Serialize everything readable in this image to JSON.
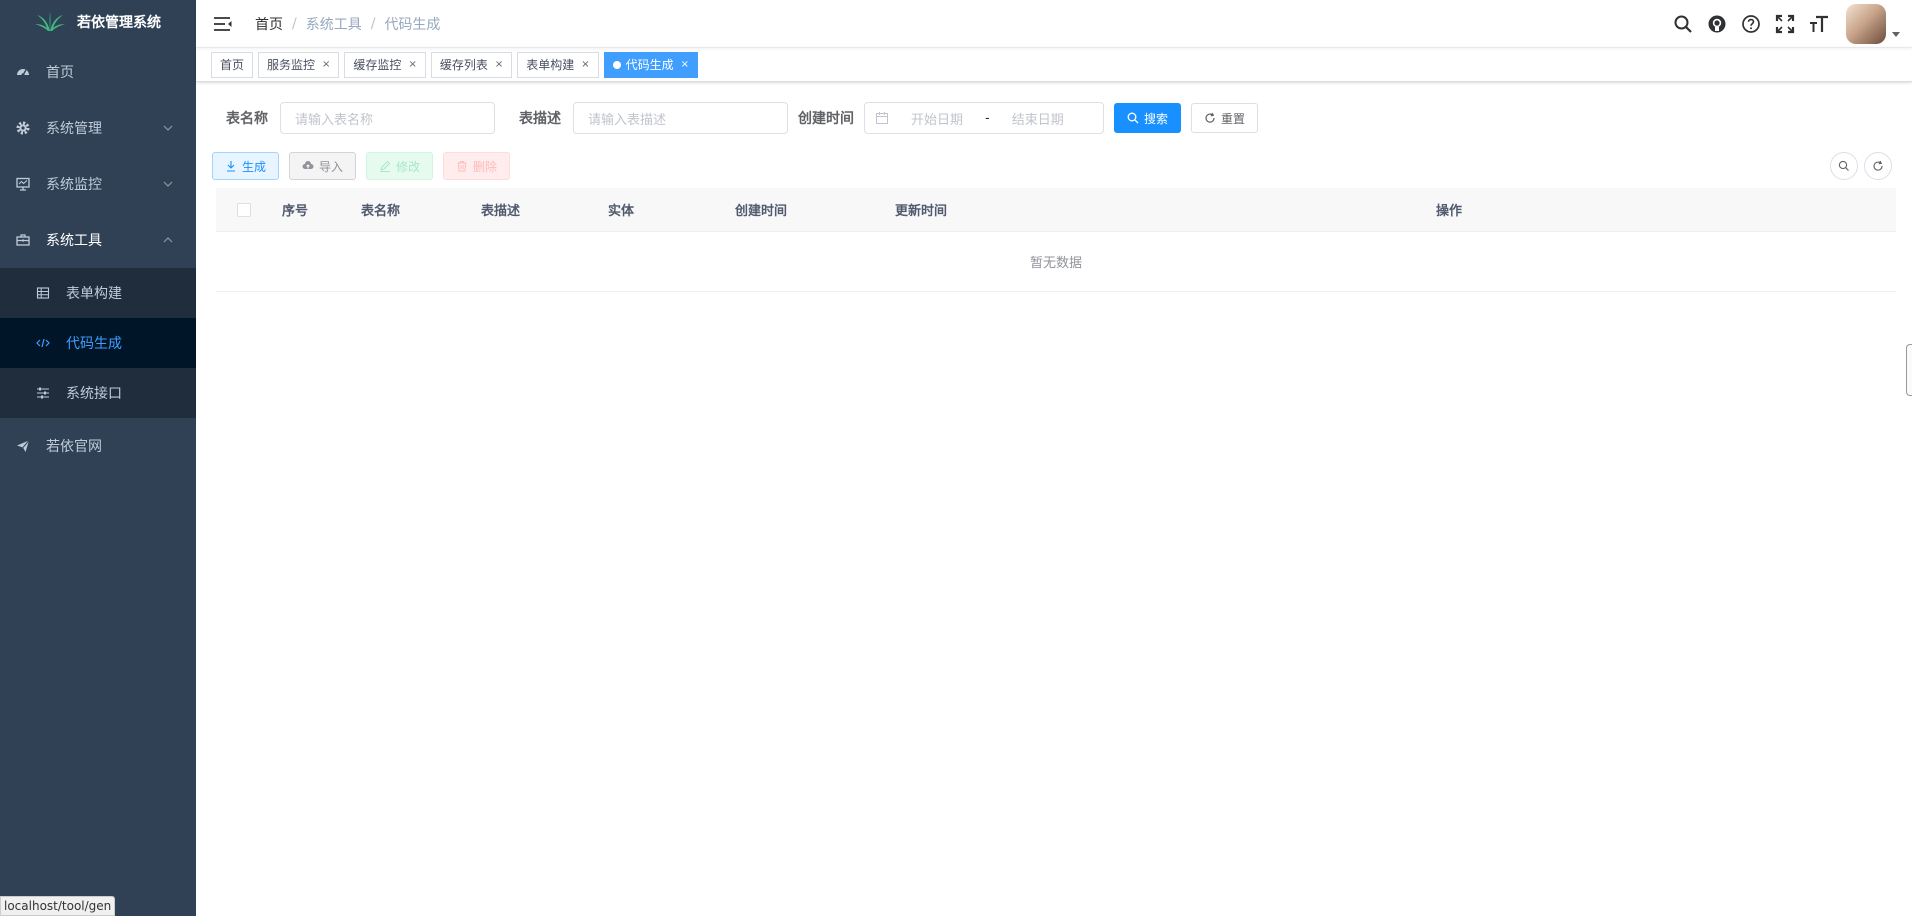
{
  "app": {
    "title": "若依管理系统"
  },
  "sidebar": {
    "items": [
      {
        "label": "首页",
        "icon": "dashboard-icon"
      },
      {
        "label": "系统管理",
        "icon": "gear-icon"
      },
      {
        "label": "系统监控",
        "icon": "monitor-icon"
      },
      {
        "label": "系统工具",
        "icon": "toolbox-icon"
      }
    ],
    "sub_items": [
      {
        "label": "表单构建",
        "icon": "grid-icon"
      },
      {
        "label": "代码生成",
        "icon": "code-icon"
      },
      {
        "label": "系统接口",
        "icon": "sliders-icon"
      }
    ],
    "official_site": "若依官网"
  },
  "breadcrumb": {
    "home": "首页",
    "section": "系统工具",
    "current": "代码生成"
  },
  "tags": [
    "首页",
    "服务监控",
    "缓存监控",
    "缓存列表",
    "表单构建",
    "代码生成"
  ],
  "search": {
    "table_name_label": "表名称",
    "table_name_placeholder": "请输入表名称",
    "table_desc_label": "表描述",
    "table_desc_placeholder": "请输入表描述",
    "created_label": "创建时间",
    "start_date_placeholder": "开始日期",
    "range_separator": "-",
    "end_date_placeholder": "结束日期",
    "search_button": "搜索",
    "reset_button": "重置"
  },
  "toolbar": {
    "generate": "生成",
    "import": "导入",
    "edit": "修改",
    "delete": "删除"
  },
  "table": {
    "columns": [
      "序号",
      "表名称",
      "表描述",
      "实体",
      "创建时间",
      "更新时间",
      "操作"
    ],
    "empty_text": "暂无数据"
  },
  "status_url": "localhost/tool/gen",
  "colors": {
    "sidebar_bg": "#304156",
    "active_menu": "#409eff",
    "tag_active": "#42b983",
    "primary": "#1890ff"
  }
}
